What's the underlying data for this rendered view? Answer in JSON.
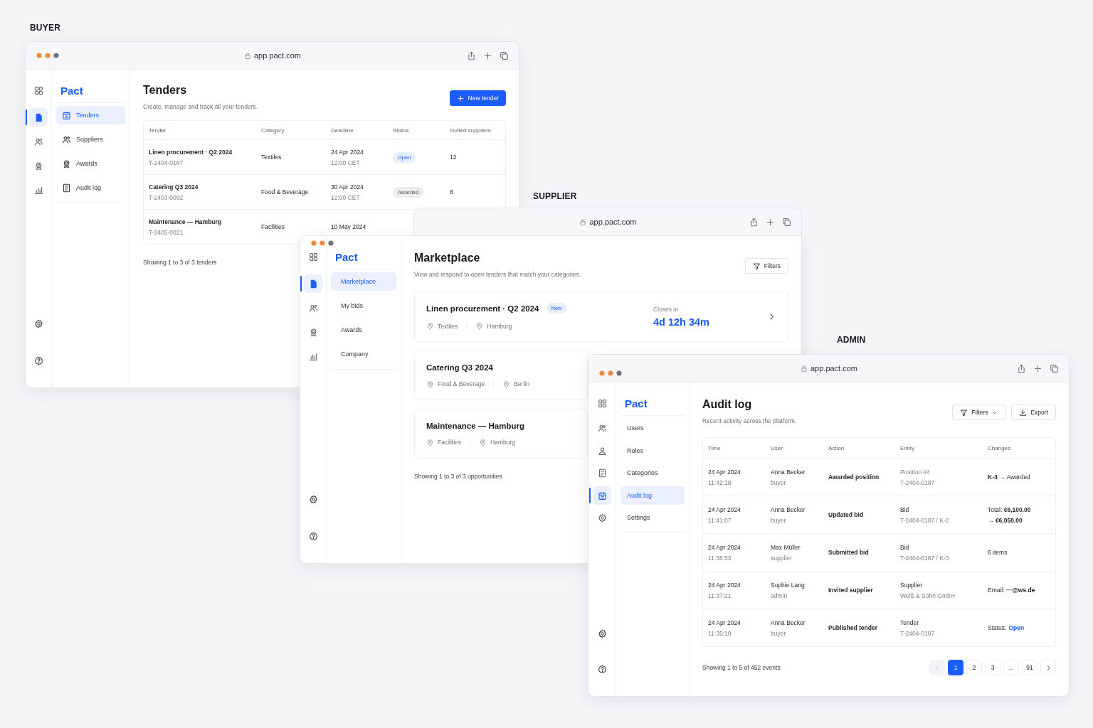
{
  "windows": [
    {
      "role": "BUYER",
      "url": "app.pact.com",
      "brand": "Pact",
      "rail": [
        {
          "kind": "grid",
          "selected": false
        },
        {
          "kind": "doc",
          "selected": true
        },
        {
          "kind": "users",
          "selected": false
        },
        {
          "kind": "award",
          "selected": false
        },
        {
          "kind": "chart",
          "selected": false
        }
      ],
      "rail_footer": [
        {
          "kind": "gear"
        },
        {
          "kind": "help"
        }
      ],
      "nav": [
        {
          "label": "Tenders",
          "kind": "icon",
          "selected": true
        },
        {
          "label": "Suppliers",
          "kind": "icon",
          "selected": false
        },
        {
          "label": "Awards",
          "kind": "icon",
          "selected": false
        },
        {
          "label": "Audit log",
          "kind": "icon",
          "selected": false
        }
      ],
      "page": {
        "kind": "tenders",
        "title": "Tenders",
        "subtitle": "Create, manage and track all your tenders.",
        "actions": [
          {
            "kind": "primary",
            "label": "New tender"
          }
        ],
        "table": {
          "columns": [
            "Tender",
            "Category",
            "Deadline",
            "Status",
            "Invited suppliers"
          ],
          "rows": [
            {
              "tender": "Linen procurement · Q2 2024",
              "id": "T-2404-0187",
              "category": "Textiles",
              "deadline_date": "24 Apr 2024",
              "deadline_time": "12:00 CET",
              "status": {
                "label": "Open",
                "kind": "open"
              },
              "invited": "12"
            },
            {
              "tender": "Catering Q3 2024",
              "id": "T-2403-0092",
              "category": "Food & Beverage",
              "deadline_date": "30 Apr 2024",
              "deadline_time": "12:00 CET",
              "status": {
                "label": "Awarded",
                "kind": "awarded"
              },
              "invited": "8"
            },
            {
              "tender": "Maintenance — Hamburg",
              "id": "T-2405-0021",
              "category": "Facilities",
              "deadline_date": "10 May 2024"
            }
          ]
        },
        "footer": "Showing 1 to 3 of 3 tenders"
      }
    },
    {
      "role": "SUPPLIER",
      "url": "app.pact.com",
      "brand": "Pact",
      "rail": [
        {
          "kind": "grid",
          "selected": false
        },
        {
          "kind": "doc",
          "selected": true
        },
        {
          "kind": "users",
          "selected": false
        },
        {
          "kind": "award",
          "selected": false
        },
        {
          "kind": "chart",
          "selected": false
        }
      ],
      "rail_footer": [
        {
          "kind": "gear"
        },
        {
          "kind": "help"
        }
      ],
      "nav": [
        {
          "label": "Marketplace",
          "selected": true
        },
        {
          "label": "My bids",
          "selected": false
        },
        {
          "label": "Awards",
          "selected": false
        },
        {
          "label": "Company",
          "selected": false
        }
      ],
      "page": {
        "kind": "marketplace",
        "title": "Marketplace",
        "subtitle": "View and respond to open tenders that match your categories.",
        "actions": [
          {
            "kind": "outline",
            "label": "Filters"
          }
        ],
        "cards": [
          {
            "title": "Linen procurement · Q2 2024",
            "badge": "New",
            "meta": [
              "Textiles",
              "Hamburg"
            ],
            "closes_label": "Closes in",
            "closes_value": "4d 12h 34m"
          },
          {
            "title": "Catering Q3 2024",
            "meta": [
              "Food & Beverage",
              "Berlin"
            ]
          },
          {
            "title": "Maintenance — Hamburg",
            "meta": [
              "Facilities",
              "Hamburg"
            ]
          }
        ],
        "footer": "Showing 1 to 3 of 3 opportunities"
      }
    },
    {
      "role": "ADMIN",
      "url": "app.pact.com",
      "brand": "Pact",
      "rail": [
        {
          "kind": "grid",
          "selected": false
        },
        {
          "kind": "users",
          "selected": false
        },
        {
          "kind": "roles",
          "selected": false
        },
        {
          "kind": "list",
          "selected": false
        },
        {
          "kind": "calendar",
          "selected": true
        },
        {
          "kind": "gear",
          "selected": false
        }
      ],
      "rail_footer": [
        {
          "kind": "gear"
        },
        {
          "kind": "help"
        }
      ],
      "nav": [
        {
          "label": "Users",
          "selected": false
        },
        {
          "label": "Roles",
          "selected": false
        },
        {
          "label": "Categories",
          "selected": false
        },
        {
          "label": "Audit log",
          "selected": true
        },
        {
          "label": "Settings",
          "selected": false
        }
      ],
      "page": {
        "kind": "audit",
        "title": "Audit log",
        "subtitle": "Recent activity across the platform.",
        "actions": [
          {
            "kind": "outline",
            "label": "Filters",
            "caret": true
          },
          {
            "kind": "outline",
            "label": "Export",
            "caret": false
          }
        ],
        "table": {
          "columns": [
            "Time",
            "User",
            "Action",
            "Entity",
            "Changes"
          ],
          "rows": [
            {
              "date": "24 Apr 2024",
              "time": "11:42:18",
              "user": "Anna Becker",
              "role": "buyer",
              "action": "Awarded position",
              "entity": "Position #4",
              "entity_muted": true,
              "entity_ref": "T-2404-0187",
              "changes": [
                "**K-3** → Awarded"
              ]
            },
            {
              "date": "24 Apr 2024",
              "time": "11:41:07",
              "user": "Anna Becker",
              "role": "buyer",
              "action": "Updated bid",
              "entity": "Bid",
              "entity_muted": false,
              "entity_ref": "T-2404-0187 / K-2",
              "changes": [
                "Total: **€6,100.00**",
                "→ **€6,050.00**"
              ]
            },
            {
              "date": "24 Apr 2024",
              "time": "11:38:53",
              "user": "Max Müller",
              "role": "supplier",
              "action": "Submitted bid",
              "entity": "Bid",
              "entity_muted": false,
              "entity_ref": "T-2404-0187 / K-3",
              "changes": [
                "6 items"
              ]
            },
            {
              "date": "24 Apr 2024",
              "time": "11:37:21",
              "user": "Sophie Lang",
              "role": "admin",
              "action": "Invited supplier",
              "entity": "Supplier",
              "entity_muted": false,
              "entity_ref": "Weiß & Sohn GmbH",
              "changes": [
                "Email: **···@ws.de**"
              ]
            },
            {
              "date": "24 Apr 2024",
              "time": "11:35:10",
              "user": "Anna Becker",
              "role": "buyer",
              "action": "Published tender",
              "entity": "Tender",
              "entity_muted": false,
              "entity_ref": "T-2404-0187",
              "changes_label": "Status:",
              "changes_status": "Open"
            }
          ]
        },
        "footer": "Showing 1 to 5 of 452 events",
        "pagination": [
          {
            "kind": "prev",
            "disabled": true
          },
          {
            "kind": "page",
            "label": "1",
            "selected": true
          },
          {
            "kind": "page",
            "label": "2",
            "selected": false
          },
          {
            "kind": "page",
            "label": "3",
            "selected": false
          },
          {
            "kind": "page",
            "label": "...",
            "selected": false
          },
          {
            "kind": "page",
            "label": "91",
            "selected": false
          },
          {
            "kind": "next",
            "disabled": false
          }
        ]
      }
    }
  ]
}
